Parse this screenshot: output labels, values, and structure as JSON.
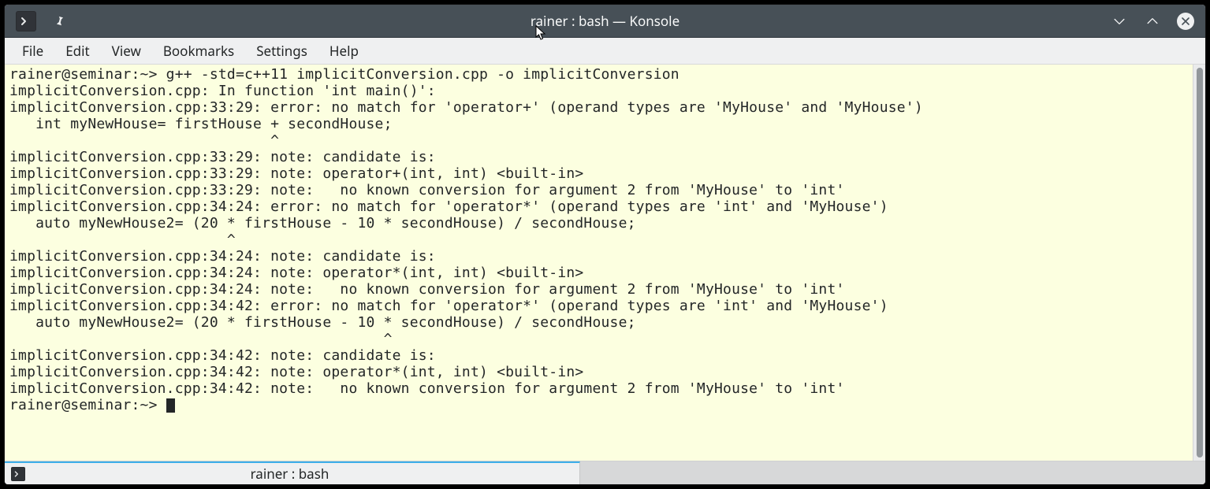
{
  "window": {
    "title": "rainer : bash — Konsole"
  },
  "menu": {
    "items": [
      "File",
      "Edit",
      "View",
      "Bookmarks",
      "Settings",
      "Help"
    ]
  },
  "terminal": {
    "lines": [
      "rainer@seminar:~> g++ -std=c++11 implicitConversion.cpp -o implicitConversion",
      "implicitConversion.cpp: In function 'int main()':",
      "implicitConversion.cpp:33:29: error: no match for 'operator+' (operand types are 'MyHouse' and 'MyHouse')",
      "   int myNewHouse= firstHouse + secondHouse;",
      "                              ^",
      "implicitConversion.cpp:33:29: note: candidate is:",
      "implicitConversion.cpp:33:29: note: operator+(int, int) <built-in>",
      "implicitConversion.cpp:33:29: note:   no known conversion for argument 2 from 'MyHouse' to 'int'",
      "implicitConversion.cpp:34:24: error: no match for 'operator*' (operand types are 'int' and 'MyHouse')",
      "   auto myNewHouse2= (20 * firstHouse - 10 * secondHouse) / secondHouse;",
      "                         ^",
      "implicitConversion.cpp:34:24: note: candidate is:",
      "implicitConversion.cpp:34:24: note: operator*(int, int) <built-in>",
      "implicitConversion.cpp:34:24: note:   no known conversion for argument 2 from 'MyHouse' to 'int'",
      "implicitConversion.cpp:34:42: error: no match for 'operator*' (operand types are 'int' and 'MyHouse')",
      "   auto myNewHouse2= (20 * firstHouse - 10 * secondHouse) / secondHouse;",
      "                                           ^",
      "implicitConversion.cpp:34:42: note: candidate is:",
      "implicitConversion.cpp:34:42: note: operator*(int, int) <built-in>",
      "implicitConversion.cpp:34:42: note:   no known conversion for argument 2 from 'MyHouse' to 'int'"
    ],
    "prompt": "rainer@seminar:~> "
  },
  "tab": {
    "label": "rainer : bash"
  }
}
